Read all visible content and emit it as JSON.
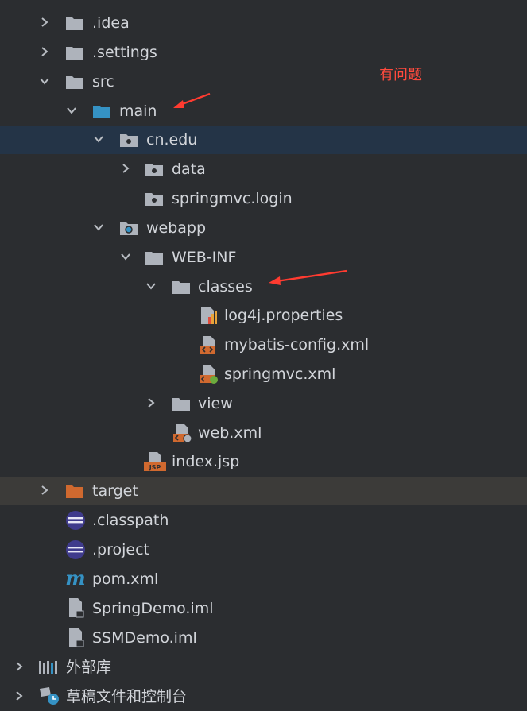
{
  "tree": {
    "items": [
      {
        "label": ".idea"
      },
      {
        "label": ".settings"
      },
      {
        "label": "src"
      },
      {
        "label": "main"
      },
      {
        "label": "cn.edu"
      },
      {
        "label": "data"
      },
      {
        "label": "springmvc.login"
      },
      {
        "label": "webapp"
      },
      {
        "label": "WEB-INF"
      },
      {
        "label": "classes"
      },
      {
        "label": "log4j.properties"
      },
      {
        "label": "mybatis-config.xml"
      },
      {
        "label": "springmvc.xml"
      },
      {
        "label": "view"
      },
      {
        "label": "web.xml"
      },
      {
        "label": "index.jsp"
      },
      {
        "label": "target"
      },
      {
        "label": ".classpath"
      },
      {
        "label": ".project"
      },
      {
        "label": "pom.xml"
      },
      {
        "label": "SpringDemo.iml"
      },
      {
        "label": "SSMDemo.iml"
      },
      {
        "label": "外部库"
      },
      {
        "label": "草稿文件和控制台"
      }
    ]
  },
  "annotation": {
    "text": "有问题",
    "color": "#ff4a3d"
  },
  "colors": {
    "background": "#2b2d30",
    "selected_row": "#243447",
    "folder_gray": "#aeb3bb",
    "folder_blue": "#3592c4",
    "folder_orange": "#d0692f"
  }
}
